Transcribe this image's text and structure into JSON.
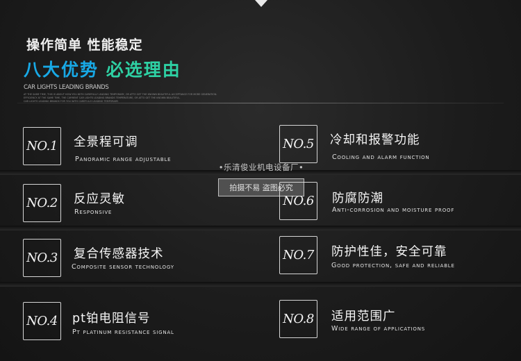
{
  "header": {
    "subtitle": "操作简单 性能稳定",
    "title_part1": "八大优势",
    "title_part2": "必选理由",
    "brand_en": "CAR LIGHTS LEADING BRANDS",
    "fine_print": [
      "AT THE SAME TIME, THIS IS ABOUT HOW YOU WITH CAREFULLY LEADING TEMPORARY, OR ATTO GET THE KNOWN BEAUTIFUL ACCEPTANCE FOR MORE GENERATION.",
      "EFFICIENCY AT THE SAME TIME, THE CURRENT CAR LIGHTS LEADING BRANDS TEMPERATURE, OR ATTO GET THE KNOWN BEAUTIFUL.",
      "CAR LIGHTS LEADING BRANDS FOR YOU WITH CAREFULLY LEADING TEMPORARY."
    ]
  },
  "features": [
    {
      "no": "NO.1",
      "zh": "全景程可调",
      "en": "Panoramic range adjustable"
    },
    {
      "no": "NO.5",
      "zh": "冷却和报警功能",
      "en": "Cooling and alarm function"
    },
    {
      "no": "NO.2",
      "zh": "反应灵敏",
      "en": "Responsive"
    },
    {
      "no": "NO.6",
      "zh": "防腐防潮",
      "en": "Anti-corrosion and moisture proof"
    },
    {
      "no": "NO.3",
      "zh": "复合传感器技术",
      "en": "Composite sensor technology"
    },
    {
      "no": "NO.7",
      "zh": "防护性佳，安全可靠",
      "en": "Good protection, safe and reliable"
    },
    {
      "no": "NO.4",
      "zh": "pt铂电阻信号",
      "en": "Pt platinum resistance signal"
    },
    {
      "no": "NO.8",
      "zh": "适用范围广",
      "en": "Wide range of applications"
    }
  ],
  "watermark": {
    "line1": "•乐清俊业机电设备厂•",
    "line2": "拍摄不易 盗图必究"
  }
}
